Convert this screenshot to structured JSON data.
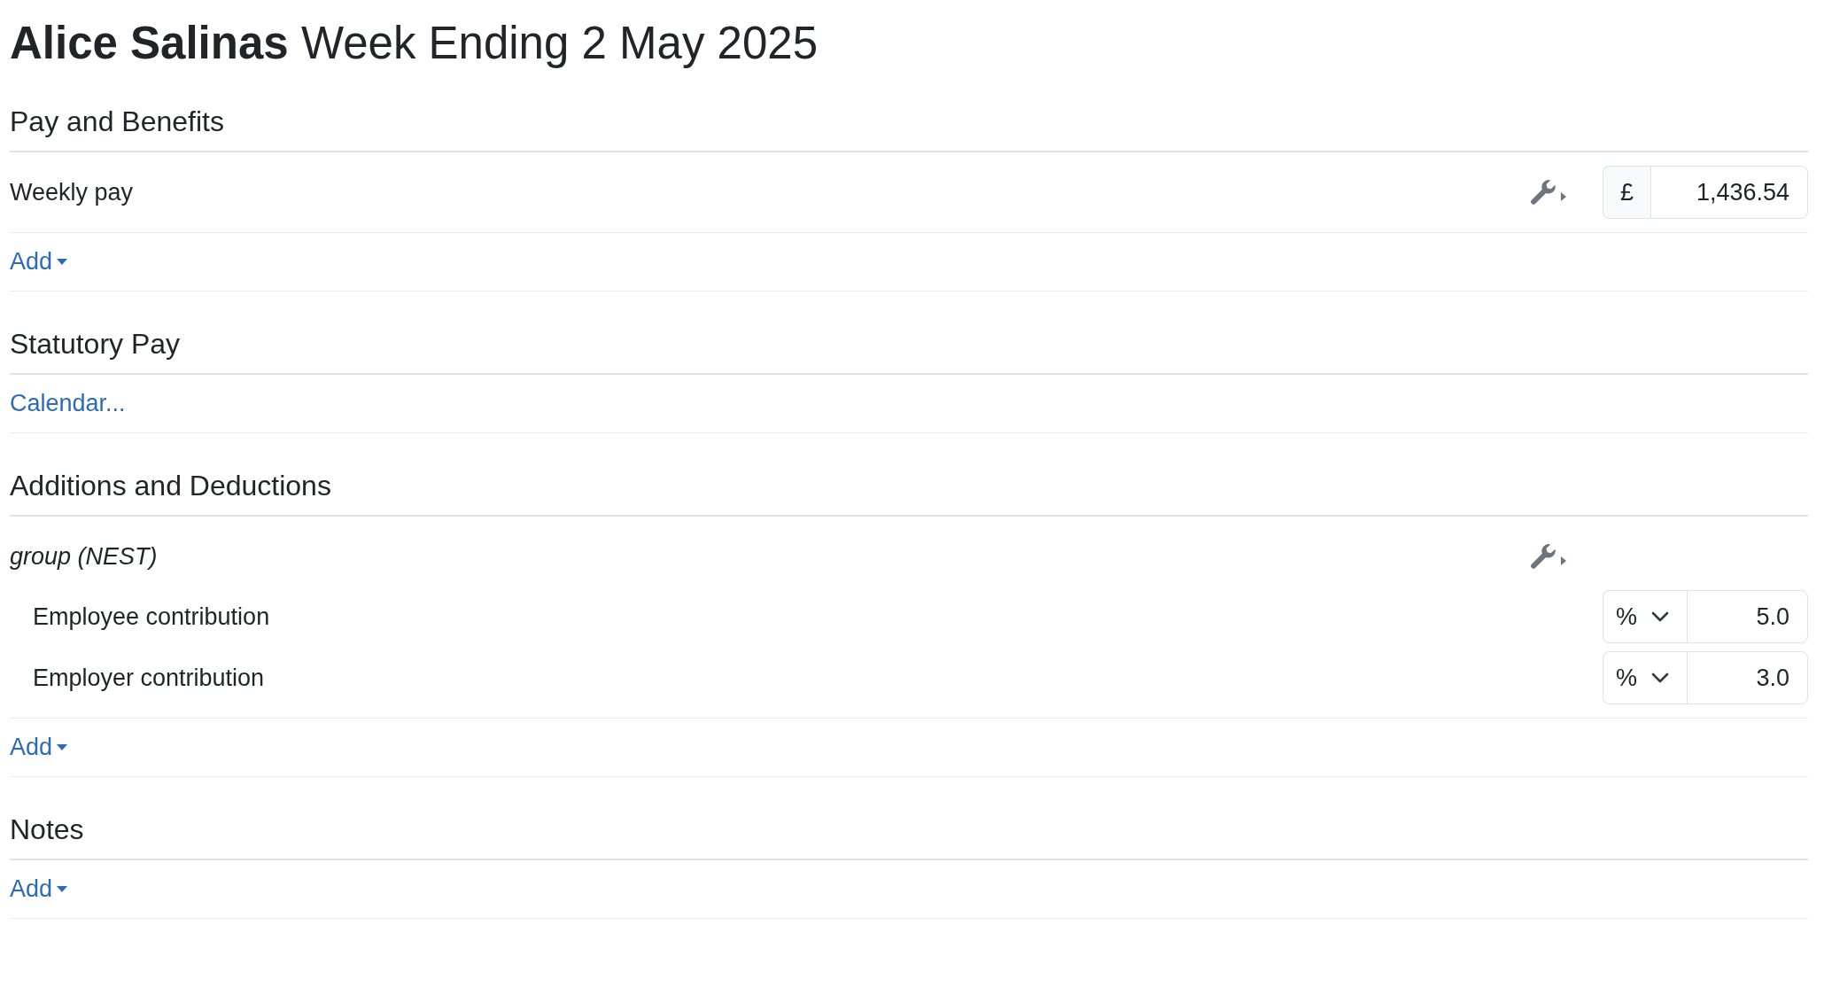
{
  "header": {
    "name": "Alice Salinas",
    "subtitle": "Week Ending 2 May 2025"
  },
  "sections": [
    {
      "title": "Pay and Benefits",
      "items": [
        {
          "kind": "amount",
          "label": "Weekly pay",
          "unit": "£",
          "value": "1,436.54"
        },
        {
          "kind": "add",
          "label": "Add"
        }
      ]
    },
    {
      "title": "Statutory Pay",
      "items": [
        {
          "kind": "link",
          "label": "Calendar..."
        }
      ]
    },
    {
      "title": "Additions and Deductions",
      "items": [
        {
          "kind": "group",
          "label": "group (NEST)",
          "children": [
            {
              "kind": "rate",
              "label": "Employee contribution",
              "unit": "%",
              "value": "5.0"
            },
            {
              "kind": "rate",
              "label": "Employer contribution",
              "unit": "%",
              "value": "3.0"
            }
          ]
        },
        {
          "kind": "add",
          "label": "Add"
        }
      ]
    },
    {
      "title": "Notes",
      "items": [
        {
          "kind": "add",
          "label": "Add"
        }
      ]
    }
  ]
}
